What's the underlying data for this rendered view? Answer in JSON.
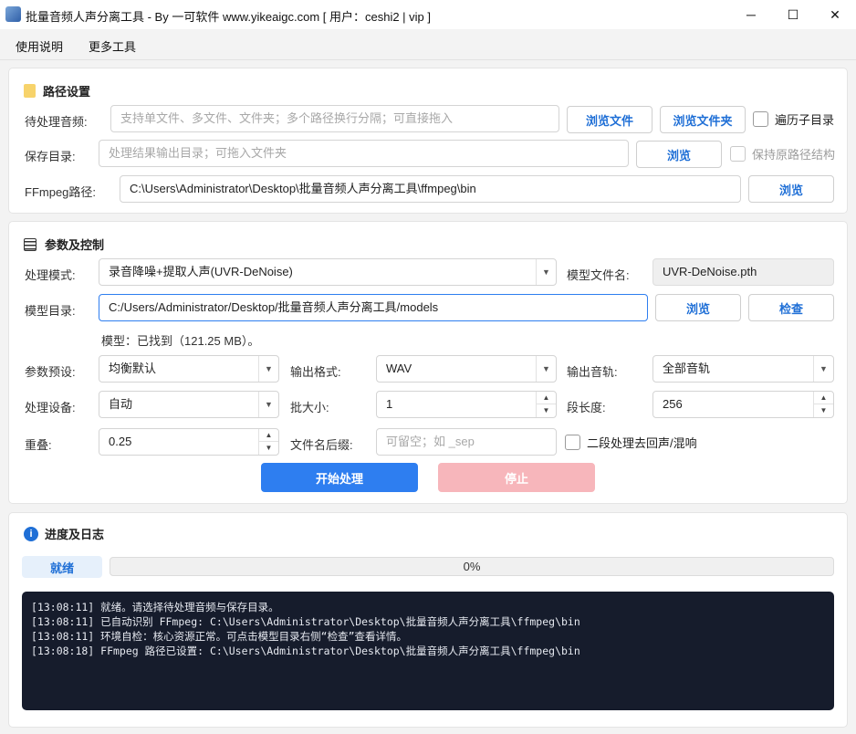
{
  "window": {
    "title": "批量音频人声分离工具 - By 一可软件 www.yikeaigc.com     [ 用户：ceshi2 | vip ]",
    "minimize_glyph": "─",
    "maximize_glyph": "☐",
    "close_glyph": "✕"
  },
  "menu": {
    "items": [
      "使用说明",
      "更多工具"
    ]
  },
  "path_section": {
    "title": "路径设置",
    "input_audio": {
      "label": "待处理音频:",
      "placeholder": "支持单文件、多文件、文件夹；多个路径换行分隔；可直接拖入",
      "browse_file": "浏览文件",
      "browse_folder": "浏览文件夹",
      "recursive_label": "遍历子目录"
    },
    "output_dir": {
      "label": "保存目录:",
      "placeholder": "处理结果输出目录；可拖入文件夹",
      "browse": "浏览",
      "keep_structure_label": "保持原路径结构"
    },
    "ffmpeg": {
      "label": "FFmpeg路径:",
      "value": "C:\\Users\\Administrator\\Desktop\\批量音频人声分离工具\\ffmpeg\\bin",
      "browse": "浏览"
    }
  },
  "params_section": {
    "title": "参数及控制",
    "mode": {
      "label": "处理模式:",
      "value": "录音降噪+提取人声(UVR-DeNoise)"
    },
    "model_file": {
      "label": "模型文件名:",
      "value": "UVR-DeNoise.pth"
    },
    "model_dir": {
      "label": "模型目录:",
      "value": "C:/Users/Administrator/Desktop/批量音频人声分离工具/models",
      "browse": "浏览",
      "check": "检查"
    },
    "model_status": "模型：已找到（121.25 MB）。",
    "preset": {
      "label": "参数预设:",
      "value": "均衡默认"
    },
    "output_format": {
      "label": "输出格式:",
      "value": "WAV"
    },
    "output_track": {
      "label": "输出音轨:",
      "value": "全部音轨"
    },
    "device": {
      "label": "处理设备:",
      "value": "自动"
    },
    "batch": {
      "label": "批大小:",
      "value": "1"
    },
    "segment": {
      "label": "段长度:",
      "value": "256"
    },
    "overlap": {
      "label": "重叠:",
      "value": "0.25"
    },
    "suffix": {
      "label": "文件名后缀:",
      "placeholder": "可留空；如 _sep"
    },
    "second_pass_label": "二段处理去回声/混响",
    "start_button": "开始处理",
    "stop_button": "停止"
  },
  "progress_section": {
    "title": "进度及日志",
    "status": "就绪",
    "percent": "0%",
    "progress_value": 0,
    "log": [
      "[13:08:11] 就绪。请选择待处理音频与保存目录。",
      "[13:08:11] 已自动识别 FFmpeg: C:\\Users\\Administrator\\Desktop\\批量音频人声分离工具\\ffmpeg\\bin",
      "[13:08:11] 环境自检：核心资源正常。可点击模型目录右侧“检查”查看详情。",
      "[13:08:18] FFmpeg 路径已设置: C:\\Users\\Administrator\\Desktop\\批量音频人声分离工具\\ffmpeg\\bin"
    ]
  },
  "colors": {
    "accent": "#1f6fd6",
    "primary_button": "#2e7ef0",
    "stop_button_disabled": "#f7b6bb",
    "log_background": "#161c2c",
    "status_badge": "#e6f0fb"
  },
  "icons": {
    "app": "app-icon",
    "path_section": "folder-icon",
    "params_section": "list-icon",
    "progress_section": "info-icon"
  }
}
